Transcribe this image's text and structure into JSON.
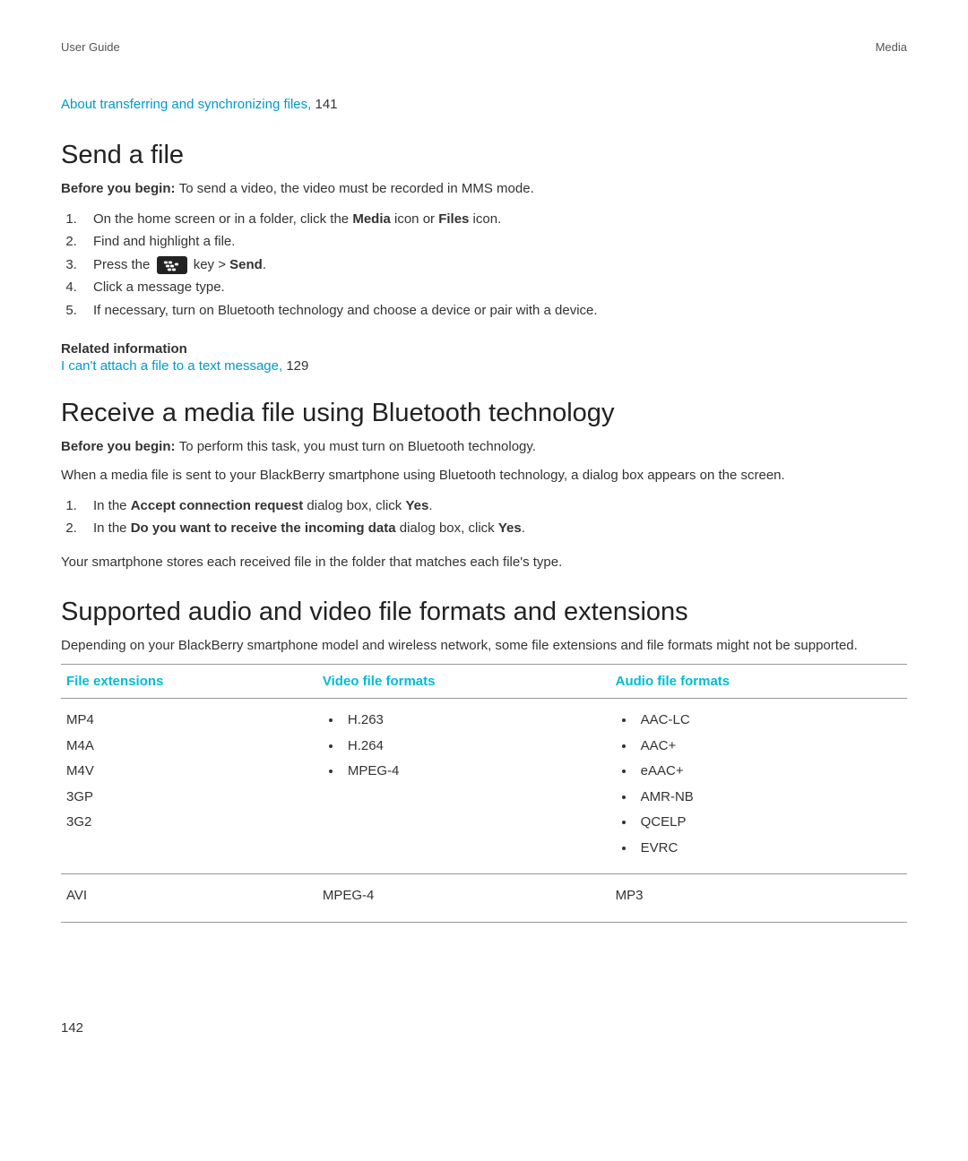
{
  "header": {
    "left": "User Guide",
    "right": "Media"
  },
  "top_link": {
    "text": "About transferring and synchronizing files, ",
    "pagenum": "141"
  },
  "section1": {
    "heading": "Send a file",
    "before_label": "Before you begin: ",
    "before_text": "To send a video, the video must be recorded in MMS mode.",
    "steps": {
      "s1a": "On the home screen or in a folder, click the ",
      "s1b": "Media",
      "s1c": " icon or ",
      "s1d": "Files",
      "s1e": " icon.",
      "s2": "Find and highlight a file.",
      "s3a": "Press the ",
      "s3b": " key > ",
      "s3c": "Send",
      "s3d": ".",
      "s4": "Click a message type.",
      "s5": "If necessary, turn on Bluetooth technology and choose a device or pair with a device."
    },
    "related_heading": "Related information",
    "related_link": "I can't attach a file to a text message, ",
    "related_pagenum": "129"
  },
  "section2": {
    "heading": "Receive a media file using Bluetooth technology",
    "before_label": "Before you begin: ",
    "before_text": "To perform this task, you must turn on Bluetooth technology.",
    "para1": "When a media file is sent to your BlackBerry smartphone using Bluetooth technology, a dialog box appears on the screen.",
    "steps": {
      "s1a": "In the ",
      "s1b": "Accept connection request",
      "s1c": " dialog box, click ",
      "s1d": "Yes",
      "s1e": ".",
      "s2a": "In the ",
      "s2b": "Do you want to receive the incoming data",
      "s2c": " dialog box, click ",
      "s2d": "Yes",
      "s2e": "."
    },
    "para2": "Your smartphone stores each received file in the folder that matches each file's type."
  },
  "section3": {
    "heading": "Supported audio and video file formats and extensions",
    "intro": "Depending on your BlackBerry smartphone model and wireless network, some file extensions and file formats might not be supported.",
    "table": {
      "headers": {
        "c1": "File extensions",
        "c2": "Video file formats",
        "c3": "Audio file formats"
      },
      "row1": {
        "ext": {
          "e1": "MP4",
          "e2": "M4A",
          "e3": "M4V",
          "e4": "3GP",
          "e5": "3G2"
        },
        "video": {
          "v1": "H.263",
          "v2": "H.264",
          "v3": "MPEG-4"
        },
        "audio": {
          "a1": "AAC-LC",
          "a2": "AAC+",
          "a3": "eAAC+",
          "a4": "AMR-NB",
          "a5": "QCELP",
          "a6": "EVRC"
        }
      },
      "row2": {
        "ext": "AVI",
        "video": "MPEG-4",
        "audio": "MP3"
      }
    }
  },
  "page_number": "142"
}
